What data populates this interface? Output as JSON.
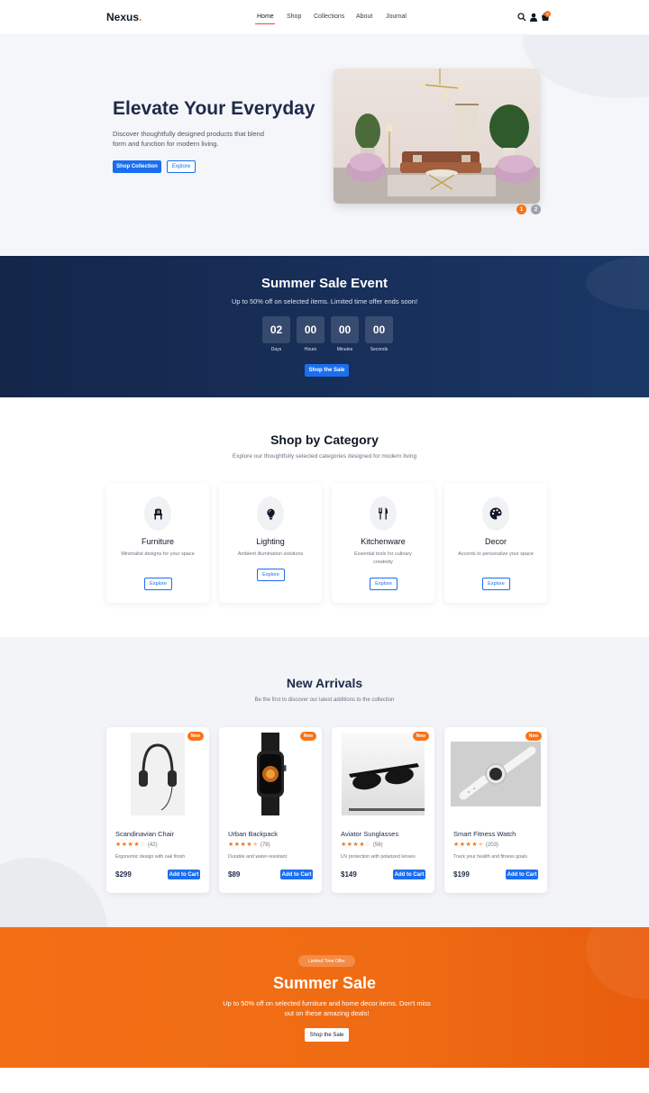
{
  "brand": {
    "name": "Nexus",
    "dot": "."
  },
  "nav": {
    "links": [
      "Home",
      "Shop",
      "Collections",
      "About",
      "Journal"
    ],
    "cart_count": "3"
  },
  "hero": {
    "title": "Elevate Your Everyday",
    "description": "Discover thoughtfully designed products that blend form and function for modern living.",
    "primary_button": "Shop Collection",
    "secondary_button": "Explore",
    "slides": [
      "1",
      "2"
    ]
  },
  "sale_event": {
    "title": "Summer Sale Event",
    "subtitle": "Up to 50% off on selected items. Limited time offer ends soon!",
    "countdown": [
      {
        "value": "02",
        "label": "Days"
      },
      {
        "value": "00",
        "label": "Hours"
      },
      {
        "value": "00",
        "label": "Minutes"
      },
      {
        "value": "00",
        "label": "Seconds"
      }
    ],
    "button": "Shop the Sale"
  },
  "categories": {
    "title": "Shop by Category",
    "subtitle": "Explore our thoughtfully selected categories designed for modern living",
    "items": [
      {
        "name": "Furniture",
        "description": "Minimalist designs for your space",
        "button": "Explore",
        "icon": "chair-icon"
      },
      {
        "name": "Lighting",
        "description": "Ambient illumination solutions",
        "button": "Explore",
        "icon": "lightbulb-icon"
      },
      {
        "name": "Kitchenware",
        "description": "Essential tools for culinary creativity",
        "button": "Explore",
        "icon": "utensils-icon"
      },
      {
        "name": "Decor",
        "description": "Accents to personalize your space",
        "button": "Explore",
        "icon": "palette-icon"
      }
    ]
  },
  "arrivals": {
    "title": "New Arrivals",
    "subtitle": "Be the first to discover our latest additions to the collection",
    "products": [
      {
        "badge": "New",
        "name": "Scandinavian Chair",
        "rating": 3.5,
        "reviews": "(42)",
        "description": "Ergonomic design with oak finish",
        "price": "$299",
        "button": "Add to Cart",
        "image": "headphones"
      },
      {
        "badge": "New",
        "name": "Urban Backpack",
        "rating": 4.5,
        "reviews": "(78)",
        "description": "Durable and water-resistant",
        "price": "$89",
        "button": "Add to Cart",
        "image": "smartwatch"
      },
      {
        "badge": "New",
        "name": "Aviator Sunglasses",
        "rating": 4,
        "reviews": "(56)",
        "description": "UV protection with polarized lenses",
        "price": "$149",
        "button": "Add to Cart",
        "image": "sunglasses"
      },
      {
        "badge": "New",
        "name": "Smart Fitness Watch",
        "rating": 4.5,
        "reviews": "(203)",
        "description": "Track your health and fitness goals",
        "price": "$199",
        "button": "Add to Cart",
        "image": "fitness-watch"
      }
    ]
  },
  "summer_sale": {
    "tag": "Limited Time Offer",
    "title": "Summer Sale",
    "description": "Up to 50% off on selected furniture and home decor items. Don't miss out on these amazing deals!",
    "button": "Shop the Sale"
  },
  "colors": {
    "accent": "#1a6ef0",
    "brand_orange": "#f97316",
    "navy": "#1e2a4a"
  }
}
